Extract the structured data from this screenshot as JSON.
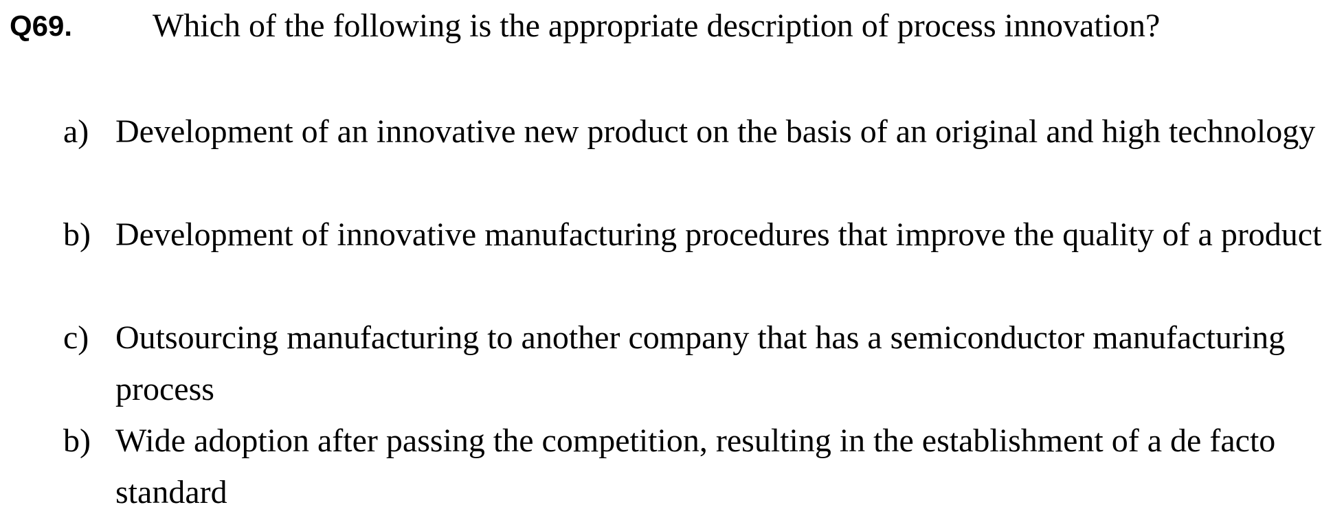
{
  "question": {
    "number": "Q69.",
    "text": "Which of the following is the appropriate description of process innovation?"
  },
  "options": [
    {
      "letter": "a)",
      "text": "Development of an innovative new product on the basis of an original and high technology"
    },
    {
      "letter": "b)",
      "text": "Development of innovative manufacturing procedures that improve the quality of a product"
    },
    {
      "letter": "c)",
      "text": "Outsourcing manufacturing to another company that has a semiconductor manufacturing process"
    },
    {
      "letter": "b)",
      "text": "Wide adoption after passing the competition, resulting in the establishment of a de facto standard"
    }
  ]
}
